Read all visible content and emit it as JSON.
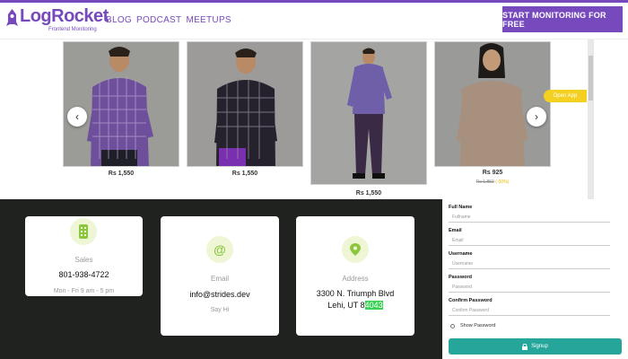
{
  "header": {
    "brand": "LogRocket",
    "brand_sub": "Frontend Monitoring",
    "nav": [
      "BLOG",
      "PODCAST",
      "MEETUPS"
    ],
    "cta": "START MONITORING FOR FREE",
    "accent": "#764abc"
  },
  "shop": {
    "products": [
      {
        "price": "Rs 1,550"
      },
      {
        "price": "Rs 1,550"
      },
      {
        "price": "Rs 1,550"
      },
      {
        "price": "Rs 925",
        "original_price": "Rs 1,850",
        "discount": "(-50%)"
      }
    ],
    "open_app": "Open App",
    "prev_icon": "chevron-left-icon",
    "next_icon": "chevron-right-icon"
  },
  "contact": {
    "sales": {
      "label": "Sales",
      "value": "801-938-4722",
      "note": "Mon - Fri 9 am - 5 pm",
      "icon": "phone-icon"
    },
    "email": {
      "label": "Email",
      "value": "info@strides.dev",
      "note": "Say Hi",
      "icon": "at-icon"
    },
    "address": {
      "label": "Address",
      "line1": "3300 N. Triumph Blvd",
      "line2_pre": "Lehi, UT 8",
      "line2_hl": "4043",
      "icon": "map-pin-icon"
    },
    "highlight_color": "#39d353"
  },
  "signup_form": {
    "fields": [
      {
        "label": "Full Name",
        "placeholder": "Fullname"
      },
      {
        "label": "Email",
        "placeholder": "Email"
      },
      {
        "label": "Username",
        "placeholder": "Username"
      },
      {
        "label": "Password",
        "placeholder": "Password"
      },
      {
        "label": "Confirm Password",
        "placeholder": "Confirm Password"
      }
    ],
    "show_password": "Show Password",
    "submit": "Signup",
    "submit_color": "#26a69a"
  }
}
